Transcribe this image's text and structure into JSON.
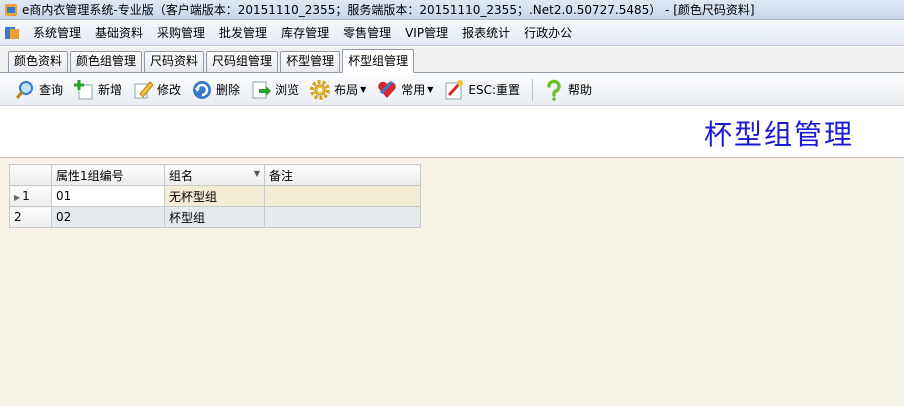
{
  "window": {
    "title": "e商内衣管理系统-专业版（客户端版本：20151110_2355；服务端版本：20151110_2355；.Net2.0.50727.5485） - [颜色尺码资料]"
  },
  "menu": {
    "items": [
      "系统管理",
      "基础资料",
      "采购管理",
      "批发管理",
      "库存管理",
      "零售管理",
      "VIP管理",
      "报表统计",
      "行政办公"
    ]
  },
  "tabs": {
    "items": [
      "颜色资料",
      "颜色组管理",
      "尺码资料",
      "尺码组管理",
      "杯型管理",
      "杯型组管理"
    ],
    "active": "杯型组管理"
  },
  "toolbar": {
    "query": "查询",
    "add": "新增",
    "edit": "修改",
    "delete": "删除",
    "browse": "浏览",
    "layout": "布局",
    "common": "常用",
    "reset": "ESC:重置",
    "help": "帮助"
  },
  "page": {
    "title": "杯型组管理"
  },
  "grid": {
    "columns": [
      "属性1组编号",
      "组名",
      "备注"
    ],
    "rows": [
      {
        "num": "1",
        "code": "01",
        "name": "无杯型组",
        "note": ""
      },
      {
        "num": "2",
        "code": "02",
        "name": "杯型组",
        "note": ""
      }
    ]
  },
  "colors": {
    "title_blue": "#1a1ad6",
    "grid_background": "#f7f3e6"
  }
}
